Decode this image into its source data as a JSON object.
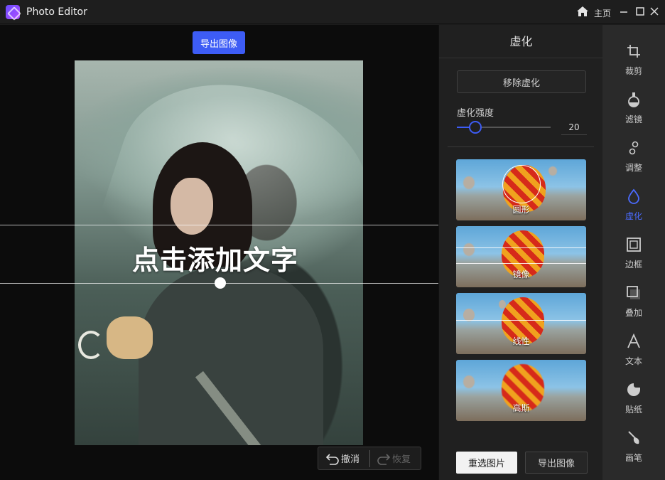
{
  "window": {
    "title": "Photo Editor",
    "home_label": "主页"
  },
  "canvas": {
    "export_label": "导出图像",
    "overlay_text": "点击添加文字",
    "undo_label": "撤消",
    "redo_label": "恢复"
  },
  "panel": {
    "title": "虚化",
    "remove_label": "移除虚化",
    "strength_label": "虚化强度",
    "strength_value": "20",
    "strength_fraction": 0.2,
    "effects": [
      {
        "label": "圆形"
      },
      {
        "label": "镜像"
      },
      {
        "label": "线性"
      },
      {
        "label": "高斯"
      }
    ],
    "reselect_label": "重选图片",
    "export_label": "导出图像"
  },
  "tools": [
    {
      "label": "裁剪",
      "icon": "crop-icon"
    },
    {
      "label": "滤镜",
      "icon": "filter-icon"
    },
    {
      "label": "调整",
      "icon": "adjust-icon"
    },
    {
      "label": "虚化",
      "icon": "blur-drop-icon",
      "active": true
    },
    {
      "label": "边框",
      "icon": "frame-icon"
    },
    {
      "label": "叠加",
      "icon": "overlay-icon"
    },
    {
      "label": "文本",
      "icon": "text-icon"
    },
    {
      "label": "贴纸",
      "icon": "sticker-icon"
    },
    {
      "label": "画笔",
      "icon": "brush-icon"
    }
  ],
  "colors": {
    "accent": "#3d5cf5",
    "active_tool": "#4b6bff"
  }
}
